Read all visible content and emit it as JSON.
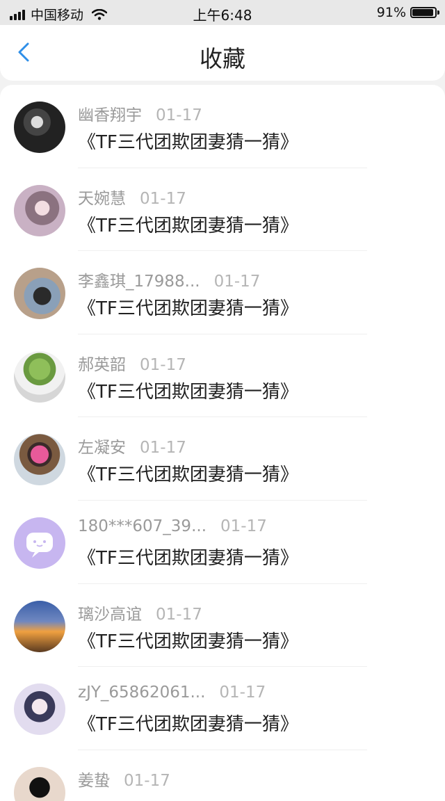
{
  "status_bar": {
    "carrier": "中国移动",
    "time": "上午6:48",
    "battery": "91%",
    "battery_level": 0.91
  },
  "header": {
    "title": "收藏",
    "back_icon": "chevron-left-icon",
    "accent_color": "#2f8fe8"
  },
  "items": [
    {
      "name": "幽香翔宇",
      "date": "01-17",
      "subject": "《TF三代团欺团妻猜一猜》"
    },
    {
      "name": "天婉慧",
      "date": "01-17",
      "subject": "《TF三代团欺团妻猜一猜》"
    },
    {
      "name": "李鑫琪_17988...",
      "date": "01-17",
      "subject": "《TF三代团欺团妻猜一猜》"
    },
    {
      "name": "郝英韶",
      "date": "01-17",
      "subject": "《TF三代团欺团妻猜一猜》"
    },
    {
      "name": "左凝安",
      "date": "01-17",
      "subject": "《TF三代团欺团妻猜一猜》"
    },
    {
      "name": "180***607_39...",
      "date": "01-17",
      "subject": "《TF三代团欺团妻猜一猜》"
    },
    {
      "name": "璃沙高谊",
      "date": "01-17",
      "subject": "《TF三代团欺团妻猜一猜》"
    },
    {
      "name": "zJY_65862061...",
      "date": "01-17",
      "subject": "《TF三代团欺团妻猜一猜》"
    },
    {
      "name": "姜蛰",
      "date": "01-17",
      "subject": ""
    }
  ]
}
